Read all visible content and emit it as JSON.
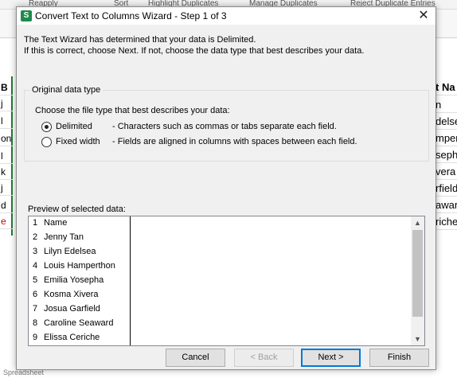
{
  "background": {
    "ribbon": [
      "Reapply",
      "Sort",
      "Highlight Duplicates",
      "Manage Duplicates",
      "Reject Duplicate Entries"
    ],
    "left_column": [
      "B",
      "j",
      "l",
      "on",
      "l",
      "k",
      "j",
      "d",
      "e"
    ],
    "right_column": [
      "t Na",
      "n",
      "delsea",
      "mper",
      "seph",
      "vera",
      "rfield",
      "awar",
      "riche"
    ],
    "status_text": "Spreadsheet"
  },
  "dialog": {
    "title": "Convert Text to Columns Wizard - Step 1 of 3",
    "app_icon_letter": "S",
    "close_label": "✕",
    "intro_line1": "The Text Wizard has determined that your data is Delimited.",
    "intro_line2": "If this is correct, choose Next. If not, choose the data type that best describes your data.",
    "original_type": {
      "legend": "Original data type",
      "prompt": "Choose the file type that best describes your data:",
      "options": [
        {
          "label": "Delimited",
          "description": "- Characters such as commas or tabs separate each field.",
          "checked": true
        },
        {
          "label": "Fixed width",
          "description": "- Fields are aligned in columns with spaces between each field.",
          "checked": false
        }
      ]
    },
    "preview": {
      "label": "Preview of selected data:",
      "rows": [
        {
          "num": "1",
          "value": "Name"
        },
        {
          "num": "2",
          "value": "Jenny Tan"
        },
        {
          "num": "3",
          "value": "Lilyn Edelsea"
        },
        {
          "num": "4",
          "value": "Louis Hamperthon"
        },
        {
          "num": "5",
          "value": "Emilia Yosepha"
        },
        {
          "num": "6",
          "value": "Kosma Xivera"
        },
        {
          "num": "7",
          "value": "Josua Garfield"
        },
        {
          "num": "8",
          "value": "Caroline Seaward"
        },
        {
          "num": "9",
          "value": "Elissa Ceriche"
        }
      ],
      "scroll_up": "▲",
      "scroll_down": "▼"
    },
    "buttons": {
      "cancel": "Cancel",
      "back": "< Back",
      "next": "Next >",
      "finish": "Finish"
    }
  }
}
